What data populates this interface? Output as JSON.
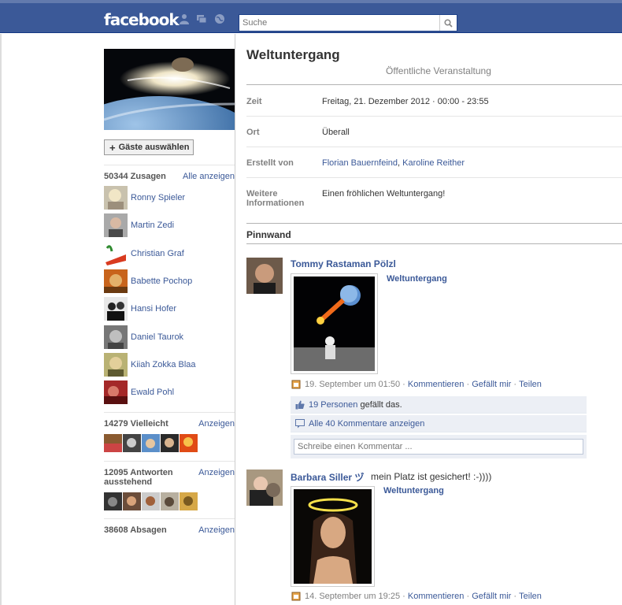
{
  "header": {
    "logo": "facebook",
    "search_placeholder": "Suche"
  },
  "sidebar": {
    "guests_button": "Gäste auswählen",
    "going": {
      "title": "50344 Zusagen",
      "link": "Alle anzeigen",
      "people": [
        "Ronny Spieler",
        "Martin Zedi",
        "Christian Graf",
        "Babette Pochop",
        "Hansi Hofer",
        "Daniel Taurok",
        "Kiiah Zokka Blaa",
        "Ewald Pohl"
      ]
    },
    "maybe": {
      "title": "14279 Vielleicht",
      "link": "Anzeigen"
    },
    "awaiting": {
      "title_line1": "12095 Antworten",
      "title_line2": "ausstehend",
      "link": "Anzeigen"
    },
    "declined": {
      "title": "38608 Absagen",
      "link": "Anzeigen"
    }
  },
  "event": {
    "title": "Weltuntergang",
    "subtitle": "Öffentliche Veranstaltung",
    "time_label": "Zeit",
    "time_value": "Freitag, 21. Dezember 2012 · 00:00 - 23:55",
    "place_label": "Ort",
    "place_value": "Überall",
    "created_label": "Erstellt von",
    "creator1": "Florian Bauernfeind",
    "creator_sep": ",",
    "creator2": "Karoline Reither",
    "more_label_line1": "Weitere",
    "more_label_line2": "Informationen",
    "more_value": "Einen fröhlichen Weltuntergang!"
  },
  "wall": {
    "title": "Pinnwand",
    "posts": [
      {
        "author": "Tommy Rastaman Pölzl",
        "message": "",
        "attachment": "Weltuntergang",
        "date": "19. September um 01:50",
        "comment": "Kommentieren",
        "like": "Gefällt mir",
        "share": "Teilen",
        "likes_link": "19 Personen",
        "likes_text": "gefällt das.",
        "comments_link": "Alle 40 Kommentare anzeigen",
        "comment_placeholder": "Schreibe einen Kommentar ..."
      },
      {
        "author": "Barbara Siller ヅ",
        "message": "mein Platz ist gesichert! :-))))",
        "attachment": "Weltuntergang",
        "date": "14. September um 19:25",
        "comment": "Kommentieren",
        "like": "Gefällt mir",
        "share": "Teilen"
      }
    ]
  },
  "meta_sep": "·",
  "colors": {
    "brand": "#3b5998",
    "topbar_border": "#133783",
    "box_bg": "#eceff5"
  }
}
